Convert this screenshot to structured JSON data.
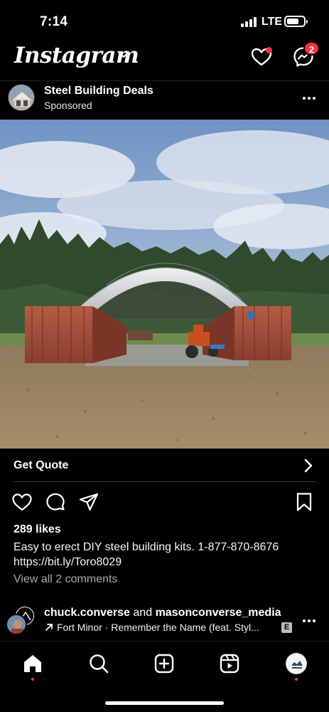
{
  "status_bar": {
    "time": "7:14",
    "network": "LTE"
  },
  "header": {
    "app_name": "Instagram",
    "messages_badge": "2",
    "brand_color": "#ff3040"
  },
  "post": {
    "account_name": "Steel Building Deals",
    "subtitle": "Sponsored",
    "cta_label": "Get Quote",
    "likes": "289 likes",
    "caption_line1": "Easy to erect DIY steel building kits. 1-877-870-8676",
    "caption_line2": "https://bit.ly/Toro8029",
    "view_comments": "View all 2 comments"
  },
  "reshare": {
    "user1": "chuck.converse",
    "connector": "and",
    "user2": "masonconverse_media",
    "song": "Fort Minor · Remember the Name (feat. Styl...",
    "explicit": "E"
  },
  "icons": {
    "header": [
      "heart-icon",
      "messenger-icon",
      "chevron-down-icon"
    ],
    "actions": [
      "like-icon",
      "comment-icon",
      "share-icon",
      "bookmark-icon"
    ],
    "nav": [
      "home-icon",
      "search-icon",
      "create-icon",
      "reels-icon",
      "profile-icon"
    ]
  }
}
